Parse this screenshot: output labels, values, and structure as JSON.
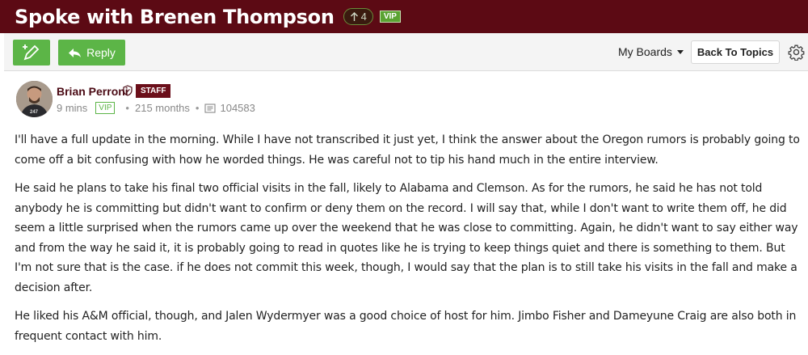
{
  "header": {
    "title": "Spoke with Brenen Thompson",
    "upvotes": "4",
    "vip_label": "VIP",
    "background_color": "#5c0a14"
  },
  "toolbar": {
    "compose_icon": "compose-pencil-icon",
    "reply_label": "Reply",
    "my_boards_label": "My Boards",
    "back_label": "Back To Topics",
    "settings_icon": "gear-icon",
    "button_color": "#5cb547"
  },
  "post": {
    "author": "Brian Perroni",
    "staff_label": "STAFF",
    "time": "9 mins",
    "vip_label": "VIP",
    "tenure": "215 months",
    "message_count": "104583",
    "paragraphs": [
      "I'll have a full update in the morning. While I have not transcribed it just yet, I think the answer about the Oregon rumors is probably going to come off a bit confusing with how he worded things. He was careful not to tip his hand much in the entire interview.",
      "He said he plans to take his final two official visits in the fall, likely to Alabama and Clemson. As for the rumors, he said he has not told anybody he is committing but didn't want to confirm or deny them on the record. I will say that, while I don't want to write them off, he did seem a little surprised when the rumors came up over the weekend that he was close to committing. Again, he didn't want to say either way and from the way he said it, it is probably going to read in quotes like he is trying to keep things quiet and there is something to them. But I'm not sure that is the case. if he does not commit this week, though, I would say that the plan is to still take his visits in the fall and make a decision after.",
      "He liked his A&M official, though, and Jalen Wydermyer was a good choice of host for him. Jimbo Fisher and Dameyune Craig are also both in frequent contact with him."
    ]
  }
}
